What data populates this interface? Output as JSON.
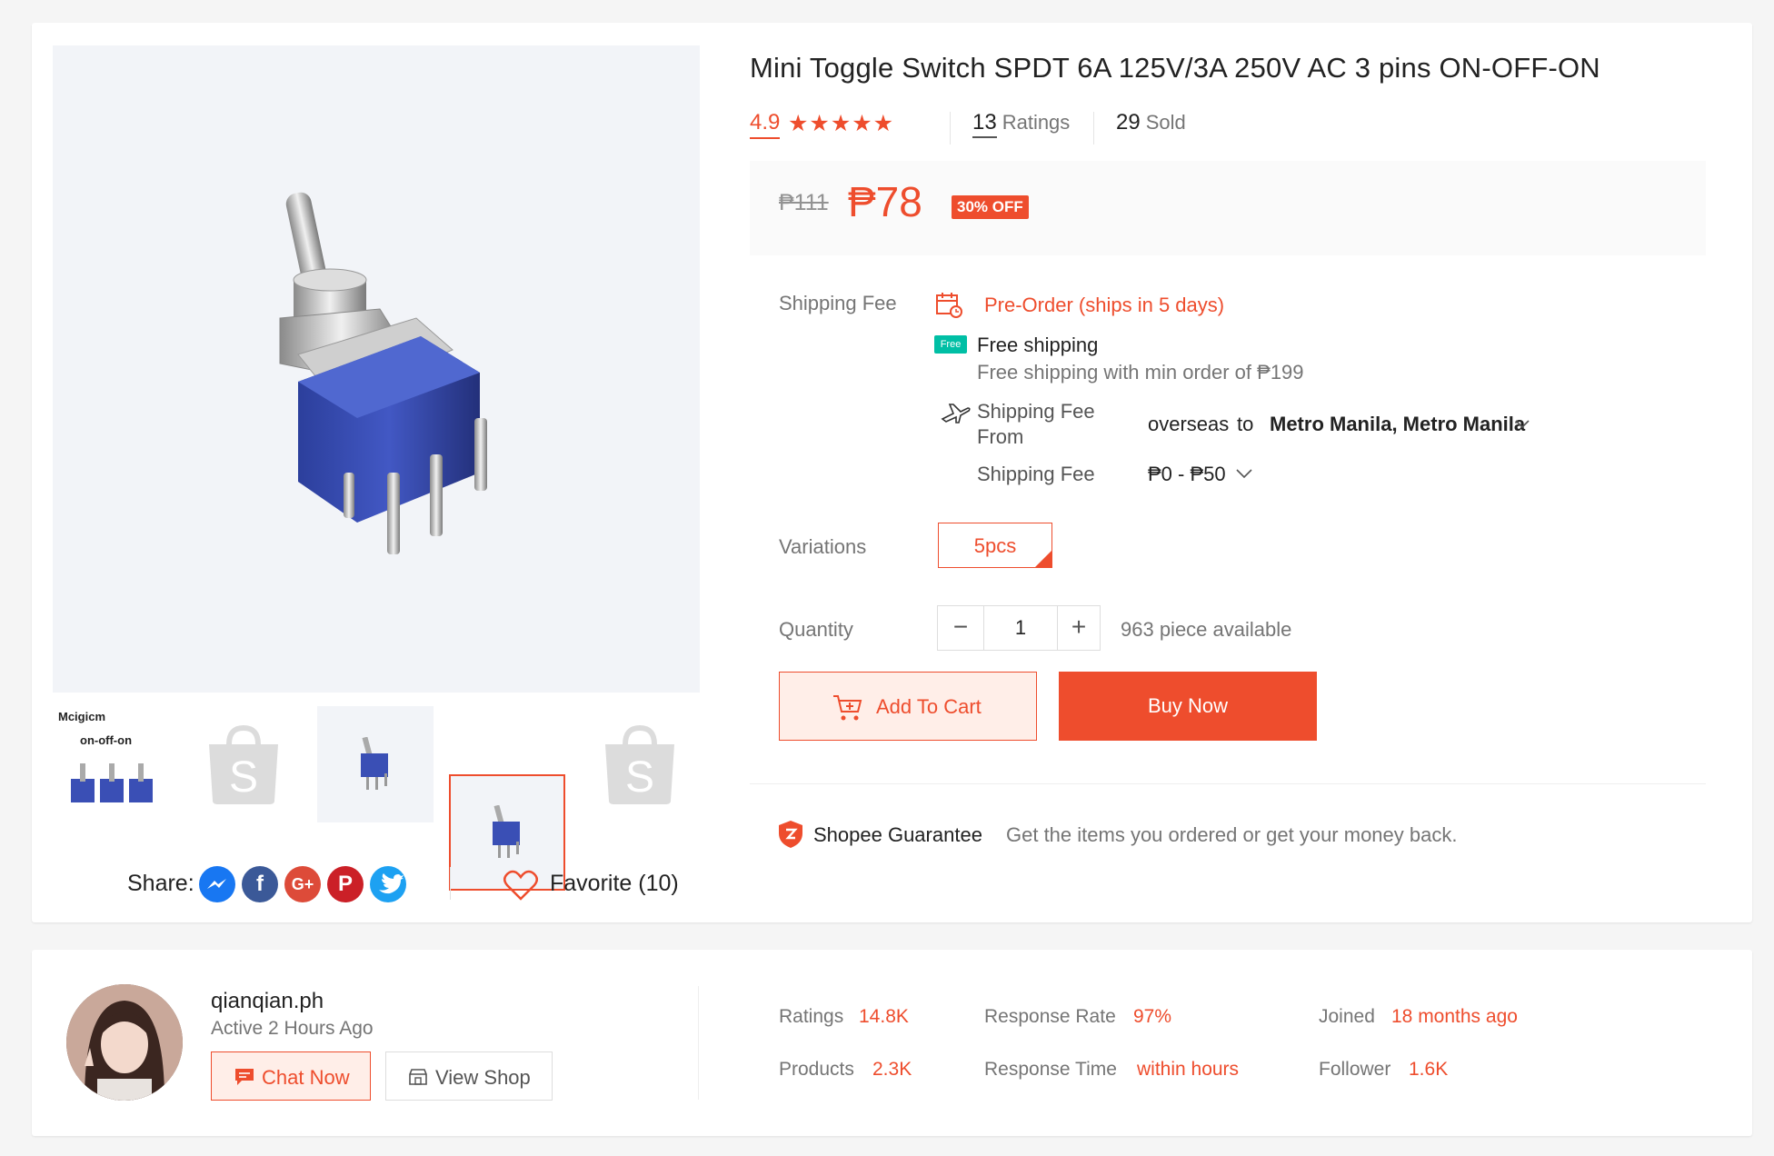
{
  "product": {
    "title": "Mini Toggle Switch SPDT 6A 125V/3A 250V AC 3 pins ON-OFF-ON",
    "rating": "4.9",
    "rating_count": "13",
    "rating_count_label": "Ratings",
    "sold_count": "29",
    "sold_label": "Sold",
    "old_price": "₱111",
    "price": "₱78",
    "discount_badge": "30% OFF",
    "thumbnail_caption_1": "Mcigicm",
    "thumbnail_caption_2": "on-off-on"
  },
  "shipping": {
    "label": "Shipping Fee",
    "preorder": "Pre-Order (ships in 5 days)",
    "free_title": "Free shipping",
    "free_badge": "Free",
    "free_sub": "Free shipping with min order of ₱199",
    "from_label": "Shipping Fee From",
    "from_value": "overseas",
    "to_word": "to",
    "destination": "Metro Manila, Metro Manila",
    "fee_label": "Shipping Fee",
    "fee_value": "₱0 - ₱50"
  },
  "variations": {
    "label": "Variations",
    "selected": "5pcs"
  },
  "quantity": {
    "label": "Quantity",
    "value": "1",
    "minus": "−",
    "plus": "+",
    "available": "963 piece available"
  },
  "actions": {
    "add_to_cart": "Add To Cart",
    "buy_now": "Buy Now"
  },
  "guarantee": {
    "title": "Shopee Guarantee",
    "text": "Get the items you ordered or get your money back."
  },
  "share": {
    "label": "Share:",
    "favorite": "Favorite (10)"
  },
  "seller": {
    "name": "qianqian.ph",
    "active": "Active 2 Hours Ago",
    "chat_now": "Chat Now",
    "view_shop": "View Shop",
    "stats": {
      "ratings_label": "Ratings",
      "ratings_value": "14.8K",
      "products_label": "Products",
      "products_value": "2.3K",
      "response_rate_label": "Response Rate",
      "response_rate_value": "97%",
      "response_time_label": "Response Time",
      "response_time_value": "within hours",
      "joined_label": "Joined",
      "joined_value": "18 months ago",
      "follower_label": "Follower",
      "follower_value": "1.6K"
    }
  },
  "colors": {
    "accent": "#ee4d2d",
    "free_ship": "#00bfa5"
  }
}
